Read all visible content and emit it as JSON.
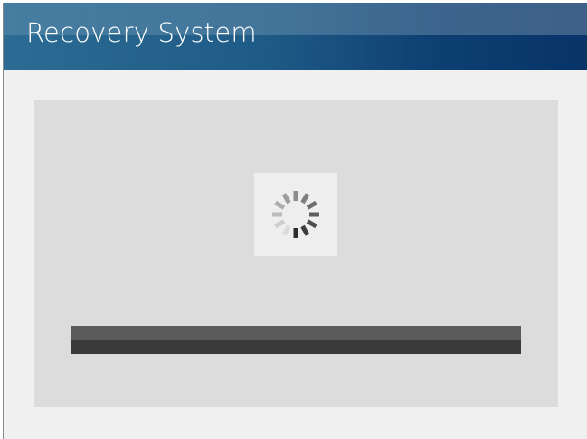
{
  "app": {
    "title": "Recovery System"
  },
  "spinner": {
    "icon": "loading-spinner-icon",
    "segment_count": 12
  },
  "progress": {
    "value": 0
  },
  "colors": {
    "header_start": "#2c6c94",
    "header_end": "#083468",
    "panel_background": "#dcdcdc",
    "progress_track": "#3a3a3a"
  }
}
